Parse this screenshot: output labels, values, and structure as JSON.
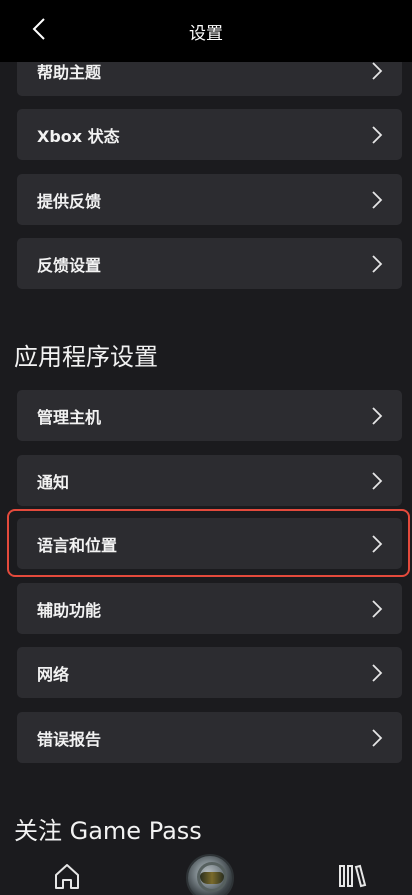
{
  "header": {
    "title": "设置",
    "back_icon": "back-chevron-icon"
  },
  "top_items": [
    {
      "label": "帮助主题"
    },
    {
      "label": "Xbox 状态"
    },
    {
      "label": "提供反馈"
    },
    {
      "label": "反馈设置"
    }
  ],
  "app_settings": {
    "title": "应用程序设置",
    "items": [
      {
        "label": "管理主机"
      },
      {
        "label": "通知"
      },
      {
        "label": "语言和位置"
      },
      {
        "label": "辅助功能"
      },
      {
        "label": "网络"
      },
      {
        "label": "错误报告"
      }
    ]
  },
  "next_section": {
    "title": "关注 Game Pass"
  },
  "colors": {
    "highlight": "#e44a3c",
    "row_bg": "#2c2c30",
    "page_bg": "#1b1b1e"
  },
  "nav": {
    "home_icon": "home-icon",
    "avatar": "profile-avatar",
    "library_icon": "library-icon"
  }
}
